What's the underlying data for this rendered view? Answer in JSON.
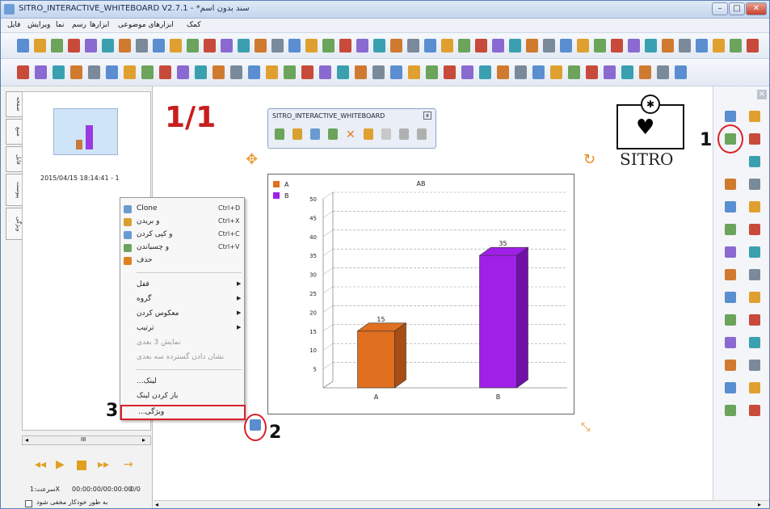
{
  "window": {
    "title": "SITRO_INTERACTIVE_WHITEBOARD V2.7.1 - *سند بدون اسم"
  },
  "menubar": {
    "items": [
      "کمک",
      "ابزارهای موضوعی",
      "ابزارها",
      "رسم",
      "نما",
      "ویرایش",
      "فایل"
    ]
  },
  "thumbnail": {
    "caption": "2015/04/15 18:14:41 - 1"
  },
  "left_tabs": [
    "صفحه",
    "منبع",
    "فایل",
    "پیوست",
    "ویژگی"
  ],
  "player": {
    "speed_label": "سرعت:1X",
    "time": "00:00:00/00:00:00",
    "pages": "0/0",
    "auto_label": "به طور خودکار مخفی شود",
    "scroll_mark": "III"
  },
  "page_counter": "1/1",
  "float_toolbar": {
    "title": "SITRO_INTERACTIVE_WHITEBOARD",
    "close": "x"
  },
  "logo": {
    "text": "SITRO"
  },
  "context_menu": {
    "items": [
      {
        "label": "Clone",
        "shortcut": "Ctrl+D"
      },
      {
        "label": "و بریدن",
        "shortcut": "Ctrl+X"
      },
      {
        "label": "و کپی کردن",
        "shortcut": "Ctrl+C"
      },
      {
        "label": "و چسباندن",
        "shortcut": "Ctrl+V"
      },
      {
        "label": "حذف",
        "shortcut": ""
      }
    ],
    "submenus": [
      {
        "label": "قفل"
      },
      {
        "label": "گروه"
      },
      {
        "label": "معکوس کردن"
      },
      {
        "label": "ترتیب"
      }
    ],
    "disabled": [
      "نمایش 3 بعدی",
      "نشان دادن گسترده سه بعدی"
    ],
    "links": [
      "...لینک",
      "باز کردن لینک"
    ],
    "properties": "...ویژگی"
  },
  "annotations": {
    "n1": "1",
    "n2": "2",
    "n3": "3"
  },
  "colors": {
    "red_annotation": "#d8202a",
    "bar_a": "#e07020",
    "bar_b": "#a020e8",
    "title_page": "#c81e1e"
  },
  "chart_data": {
    "type": "bar",
    "title": "AB",
    "categories": [
      "A",
      "B"
    ],
    "values": [
      15,
      35
    ],
    "legend": [
      "A",
      "B"
    ],
    "ylim": [
      0,
      50
    ],
    "yticks": [
      5,
      10,
      15,
      20,
      25,
      30,
      35,
      40,
      45,
      50
    ],
    "grid": true,
    "three_d": true,
    "legend_position": "top-left"
  }
}
